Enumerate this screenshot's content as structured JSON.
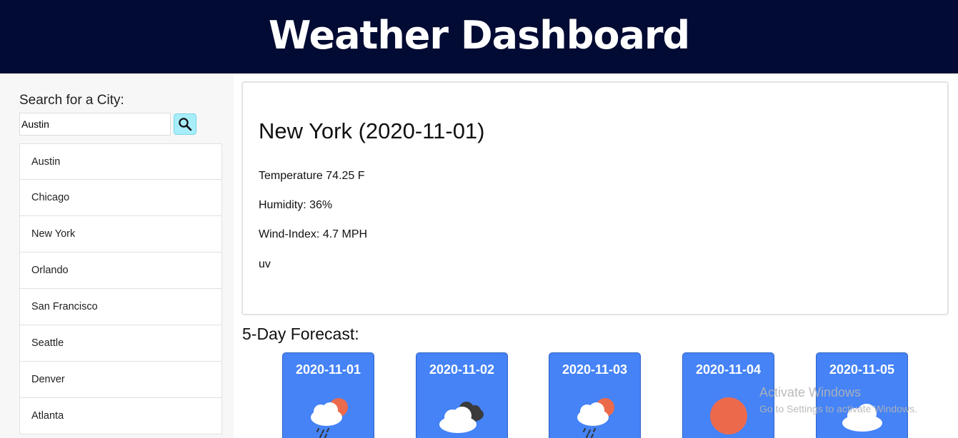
{
  "header": {
    "title": "Weather Dashboard"
  },
  "search": {
    "label": "Search for a City:",
    "value": "Austin",
    "button_icon": "search-icon"
  },
  "cities": [
    "Austin",
    "Chicago",
    "New York",
    "Orlando",
    "San Francisco",
    "Seattle",
    "Denver",
    "Atlanta"
  ],
  "current": {
    "title": "New York (2020-11-01)",
    "temperature": "Temperature 74.25 F",
    "humidity": "Humidity: 36%",
    "wind": "Wind-Index: 4.7 MPH",
    "uv": "uv"
  },
  "forecast": {
    "title": "5-Day Forecast:",
    "days": [
      {
        "date": "2020-11-01",
        "icon": "sun-cloud-rain-icon"
      },
      {
        "date": "2020-11-02",
        "icon": "clouds-icon"
      },
      {
        "date": "2020-11-03",
        "icon": "sun-cloud-rain-icon"
      },
      {
        "date": "2020-11-04",
        "icon": "sun-icon"
      },
      {
        "date": "2020-11-05",
        "icon": "cloud-icon"
      }
    ]
  },
  "watermark": {
    "line1": "Activate Windows",
    "line2": "Go to Settings to activate Windows."
  },
  "colors": {
    "header_bg": "#020b33",
    "card_blue": "#4583f6",
    "search_button": "#a7eefa",
    "sun": "#ec6a4c"
  }
}
